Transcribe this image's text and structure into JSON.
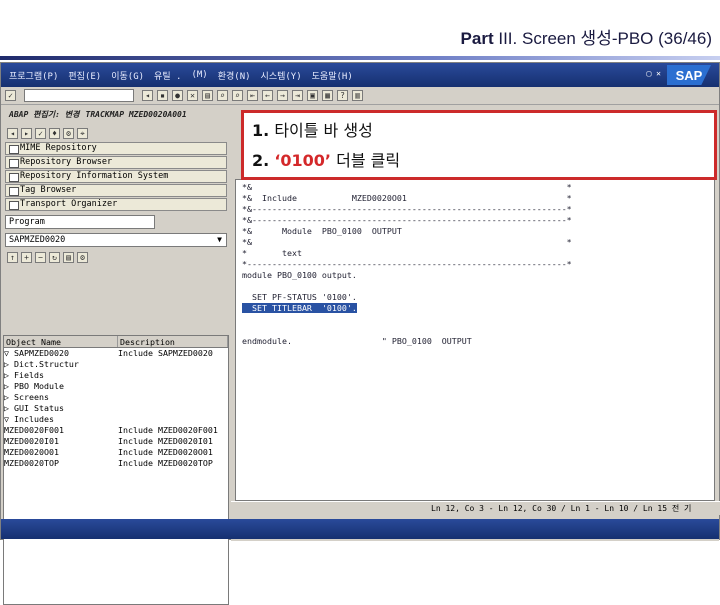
{
  "slide": {
    "title_part": "Part",
    "title_rest": "III. Screen 생성-PBO (36/46)"
  },
  "sap": {
    "menu": [
      "프로그램(P)",
      "편집(E)",
      "이동(G)",
      "유틸 .",
      "(M)",
      "환경(N)",
      "시스템(Y)",
      "도움말(H)"
    ],
    "logo": "SAP",
    "app_title": "ABAP 편집기: 변경",
    "app_sub": "TRACKMAP MZED0020A001"
  },
  "nav": {
    "buttons": [
      "MIME Repository",
      "Repository Browser",
      "Repository Information System",
      "Tag Browser",
      "Transport Organizer"
    ],
    "object_type": "Program",
    "object_name": "SAPMZED0020"
  },
  "tree": {
    "headers": [
      "Object Name",
      "Description"
    ],
    "rows": [
      {
        "name": "▽ SAPMZED0020",
        "desc": "Include SAPMZED0020"
      },
      {
        "name": "  ▷ Dict.Structur",
        "desc": ""
      },
      {
        "name": "  ▷ Fields",
        "desc": ""
      },
      {
        "name": "  ▷ PBO Module",
        "desc": ""
      },
      {
        "name": "  ▷ Screens",
        "desc": ""
      },
      {
        "name": "  ▷ GUI Status",
        "desc": ""
      },
      {
        "name": "  ▽ Includes",
        "desc": ""
      },
      {
        "name": "     MZED0020F001",
        "desc": "Include MZED0020F001"
      },
      {
        "name": "     MZED0020I01",
        "desc": "Include MZED0020I01"
      },
      {
        "name": "     MZED0020O01",
        "desc": "Include MZED0020O01"
      },
      {
        "name": "     MZED0020TOP",
        "desc": "Include MZED0020TOP"
      }
    ]
  },
  "editor": {
    "lines": [
      "*&                                                               *",
      "*&  Include           MZED0020O01                                *",
      "*&---------------------------------------------------------------*",
      "*&---------------------------------------------------------------*",
      "*&      Module  PBO_0100  OUTPUT",
      "*&                                                               *",
      "*       text",
      "*----------------------------------------------------------------*",
      "module PBO_0100 output.",
      "",
      "  SET PF-STATUS '0100'.",
      "  SET TITLEBAR  '0100'.",
      "",
      "",
      "endmodule.                  \" PBO_0100  OUTPUT"
    ],
    "highlight_index": 11
  },
  "status": {
    "text": "Ln 12, Co 3 - Ln 12, Co 30 / Ln 1 - Ln 10 / Ln 15 전 기"
  },
  "callout": {
    "step1_num": "1.",
    "step1_text": "타이틀 바 생성",
    "step2_num": "2.",
    "step2_quote_open": "‘",
    "step2_value": "0100",
    "step2_quote_close": "’",
    "step2_text": "더블 클릭"
  }
}
